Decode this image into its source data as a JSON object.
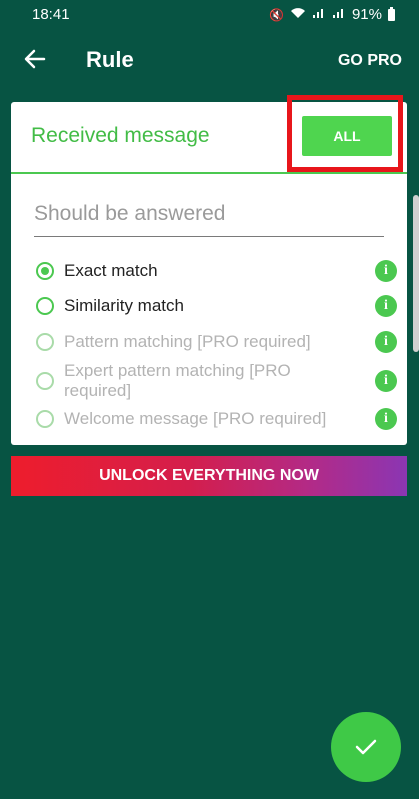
{
  "status_bar": {
    "time": "18:41",
    "battery": "91%"
  },
  "app_bar": {
    "title": "Rule",
    "go_pro": "GO PRO"
  },
  "card": {
    "header": {
      "label": "Received message",
      "all_button": "ALL"
    },
    "input": {
      "placeholder": "Should be answered",
      "value": ""
    },
    "options": [
      {
        "label": "Exact match",
        "checked": true,
        "enabled": true
      },
      {
        "label": "Similarity match",
        "checked": false,
        "enabled": true
      },
      {
        "label": "Pattern matching [PRO required]",
        "checked": false,
        "enabled": false
      },
      {
        "label": "Expert pattern matching [PRO required]",
        "checked": false,
        "enabled": false
      },
      {
        "label": "Welcome message [PRO required]",
        "checked": false,
        "enabled": false
      }
    ]
  },
  "unlock_button": "UNLOCK EVERYTHING NOW",
  "colors": {
    "background": "#075443",
    "accent": "#4bc850",
    "highlight": "#e8161b"
  },
  "icons": {
    "back": "arrow-left-icon",
    "info": "info-icon",
    "fab": "check-icon"
  }
}
